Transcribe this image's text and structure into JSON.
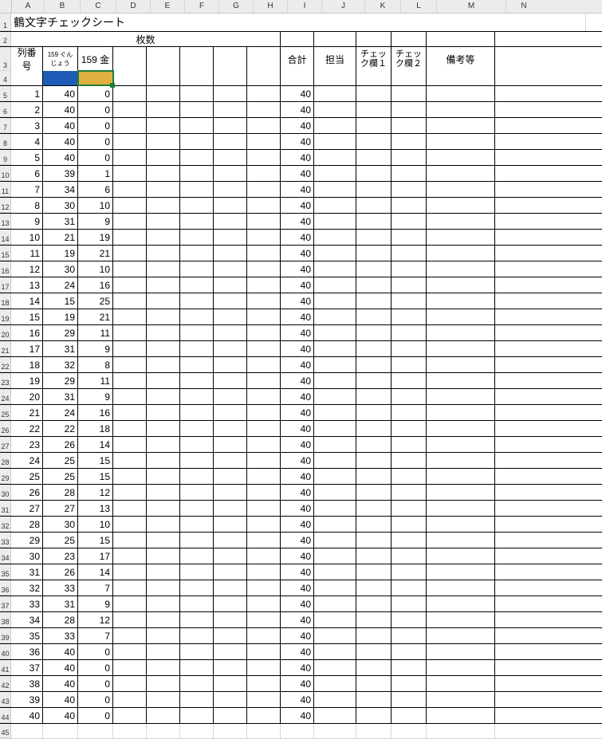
{
  "columns": [
    "A",
    "B",
    "C",
    "D",
    "E",
    "F",
    "G",
    "H",
    "I",
    "J",
    "K",
    "L",
    "M",
    "N"
  ],
  "title": "鶴文字チェックシート",
  "headers": {
    "maisu": "枚数",
    "retsu": "列番号",
    "h_b": "159 ぐんじょう",
    "h_c": "159 金",
    "goukei": "合計",
    "tantou": "担当",
    "chk1": "チェック欄１",
    "chk2": "チェック欄２",
    "bikou": "備考等"
  },
  "colors": {
    "b": "#1f5cb8",
    "c": "#e0b040"
  },
  "rows": [
    {
      "n": 1,
      "b": 40,
      "c": 0,
      "s": 40
    },
    {
      "n": 2,
      "b": 40,
      "c": 0,
      "s": 40
    },
    {
      "n": 3,
      "b": 40,
      "c": 0,
      "s": 40
    },
    {
      "n": 4,
      "b": 40,
      "c": 0,
      "s": 40
    },
    {
      "n": 5,
      "b": 40,
      "c": 0,
      "s": 40
    },
    {
      "n": 6,
      "b": 39,
      "c": 1,
      "s": 40
    },
    {
      "n": 7,
      "b": 34,
      "c": 6,
      "s": 40
    },
    {
      "n": 8,
      "b": 30,
      "c": 10,
      "s": 40
    },
    {
      "n": 9,
      "b": 31,
      "c": 9,
      "s": 40
    },
    {
      "n": 10,
      "b": 21,
      "c": 19,
      "s": 40
    },
    {
      "n": 11,
      "b": 19,
      "c": 21,
      "s": 40
    },
    {
      "n": 12,
      "b": 30,
      "c": 10,
      "s": 40
    },
    {
      "n": 13,
      "b": 24,
      "c": 16,
      "s": 40
    },
    {
      "n": 14,
      "b": 15,
      "c": 25,
      "s": 40
    },
    {
      "n": 15,
      "b": 19,
      "c": 21,
      "s": 40
    },
    {
      "n": 16,
      "b": 29,
      "c": 11,
      "s": 40
    },
    {
      "n": 17,
      "b": 31,
      "c": 9,
      "s": 40
    },
    {
      "n": 18,
      "b": 32,
      "c": 8,
      "s": 40
    },
    {
      "n": 19,
      "b": 29,
      "c": 11,
      "s": 40
    },
    {
      "n": 20,
      "b": 31,
      "c": 9,
      "s": 40
    },
    {
      "n": 21,
      "b": 24,
      "c": 16,
      "s": 40
    },
    {
      "n": 22,
      "b": 22,
      "c": 18,
      "s": 40
    },
    {
      "n": 23,
      "b": 26,
      "c": 14,
      "s": 40
    },
    {
      "n": 24,
      "b": 25,
      "c": 15,
      "s": 40
    },
    {
      "n": 25,
      "b": 25,
      "c": 15,
      "s": 40
    },
    {
      "n": 26,
      "b": 28,
      "c": 12,
      "s": 40
    },
    {
      "n": 27,
      "b": 27,
      "c": 13,
      "s": 40
    },
    {
      "n": 28,
      "b": 30,
      "c": 10,
      "s": 40
    },
    {
      "n": 29,
      "b": 25,
      "c": 15,
      "s": 40
    },
    {
      "n": 30,
      "b": 23,
      "c": 17,
      "s": 40
    },
    {
      "n": 31,
      "b": 26,
      "c": 14,
      "s": 40
    },
    {
      "n": 32,
      "b": 33,
      "c": 7,
      "s": 40
    },
    {
      "n": 33,
      "b": 31,
      "c": 9,
      "s": 40
    },
    {
      "n": 34,
      "b": 28,
      "c": 12,
      "s": 40
    },
    {
      "n": 35,
      "b": 33,
      "c": 7,
      "s": 40
    },
    {
      "n": 36,
      "b": 40,
      "c": 0,
      "s": 40
    },
    {
      "n": 37,
      "b": 40,
      "c": 0,
      "s": 40
    },
    {
      "n": 38,
      "b": 40,
      "c": 0,
      "s": 40
    },
    {
      "n": 39,
      "b": 40,
      "c": 0,
      "s": 40
    },
    {
      "n": 40,
      "b": 40,
      "c": 0,
      "s": 40
    }
  ],
  "selected_cell": "C4"
}
